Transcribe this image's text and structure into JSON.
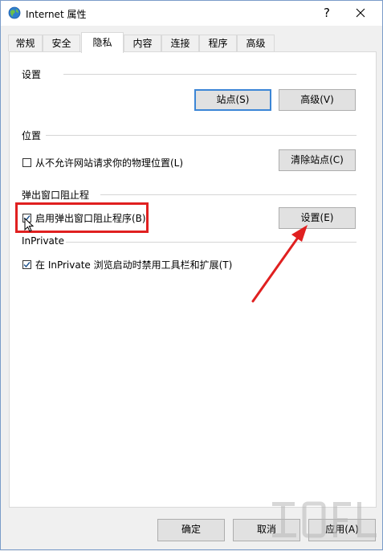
{
  "window": {
    "title": "Internet 属性",
    "help_glyph": "?",
    "close_glyph": "✕"
  },
  "tabs": [
    {
      "label": "常规",
      "active": false
    },
    {
      "label": "安全",
      "active": false
    },
    {
      "label": "隐私",
      "active": true
    },
    {
      "label": "内容",
      "active": false
    },
    {
      "label": "连接",
      "active": false
    },
    {
      "label": "程序",
      "active": false
    },
    {
      "label": "高级",
      "active": false
    }
  ],
  "settings": {
    "title": "设置",
    "sites_button": "站点(S)",
    "advanced_button": "高级(V)"
  },
  "location": {
    "title": "位置",
    "checkbox_label": "从不允许网站请求你的物理位置(L)",
    "checked": false,
    "clear_sites_button": "清除站点(C)"
  },
  "popup_blocker": {
    "title": "弹出窗口阻止程",
    "checkbox_label": "启用弹出窗口阻止程序(B)",
    "checked": true,
    "settings_button": "设置(E)"
  },
  "inprivate": {
    "title": "InPrivate",
    "checkbox_label": "在 InPrivate 浏览启动时禁用工具栏和扩展(T)",
    "checked": true
  },
  "footer": {
    "ok": "确定",
    "cancel": "取消",
    "apply": "应用(A)"
  },
  "colors": {
    "highlight": "#e02020",
    "focus_border": "#3c86d6",
    "checkmark": "#1a4f8b"
  }
}
